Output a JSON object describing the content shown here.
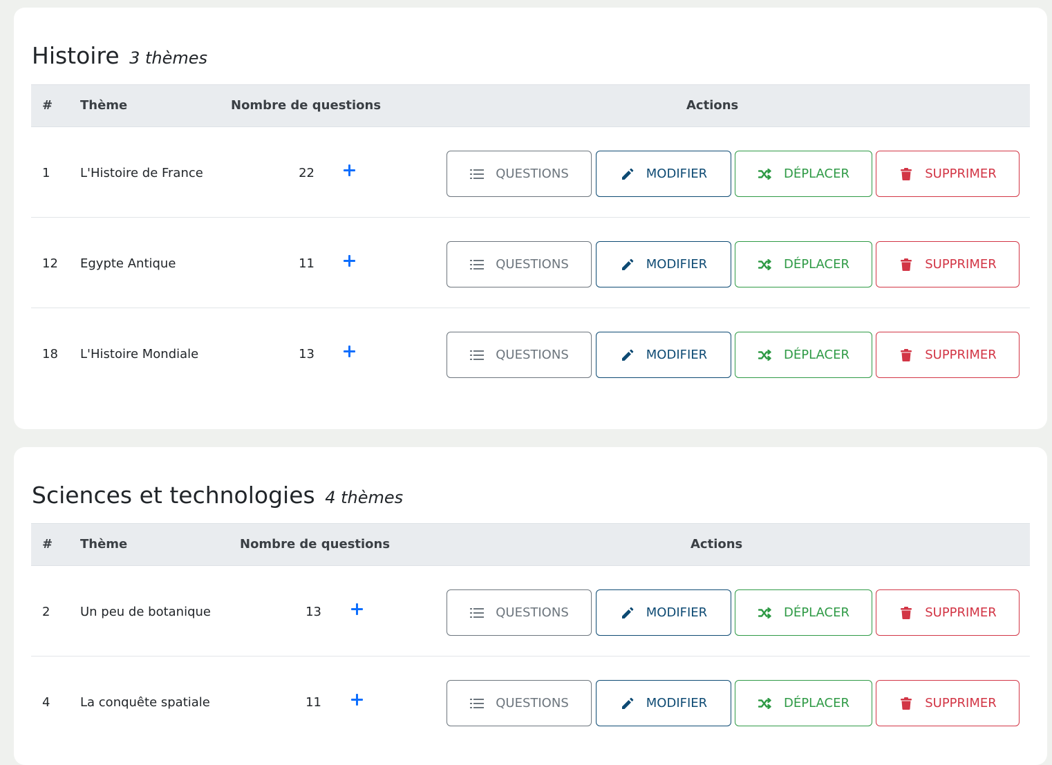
{
  "sections": [
    {
      "title": "Histoire",
      "count": "3 thèmes",
      "headers": {
        "index": "#",
        "theme": "Thème",
        "questions": "Nombre de questions",
        "actions": "Actions"
      },
      "rows": [
        {
          "index": "1",
          "theme": "L'Histoire de France",
          "questions": "22"
        },
        {
          "index": "12",
          "theme": "Egypte Antique",
          "questions": "11"
        },
        {
          "index": "18",
          "theme": "L'Histoire Mondiale",
          "questions": "13"
        }
      ]
    },
    {
      "title": "Sciences et technologies",
      "count": "4 thèmes",
      "headers": {
        "index": "#",
        "theme": "Thème",
        "questions": "Nombre de questions",
        "actions": "Actions"
      },
      "rows": [
        {
          "index": "2",
          "theme": "Un peu de botanique",
          "questions": "13"
        },
        {
          "index": "4",
          "theme": "La conquête spatiale",
          "questions": "11"
        }
      ]
    }
  ],
  "actions": {
    "questions_label": "QUESTIONS",
    "modify_label": "MODIFIER",
    "move_label": "DÉPLACER",
    "delete_label": "SUPPRIMER"
  },
  "icons": {
    "questions": "list-icon",
    "modify": "pencil-icon",
    "move": "shuffle-icon",
    "delete": "trash-icon",
    "add": "plus-icon"
  },
  "colors": {
    "background": "#eff1ee",
    "card": "#ffffff",
    "header_bg": "#e9ecef",
    "questions": "#6c757d",
    "modify": "#0d4a73",
    "move": "#2e9a45",
    "delete": "#d23545",
    "add": "#0d6efd"
  }
}
